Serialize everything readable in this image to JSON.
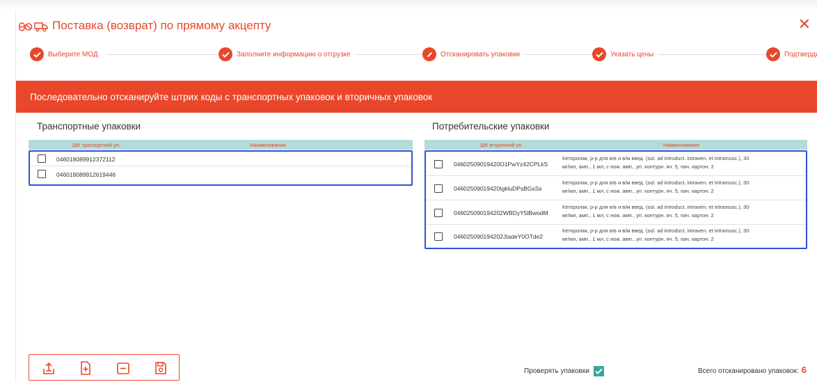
{
  "header": {
    "title": "Поставка (возврат) по прямому акцепту"
  },
  "stepper": [
    {
      "label": "Выберите МОД",
      "icon": "check-icon"
    },
    {
      "label": "Заполните информацию о отгрузке",
      "icon": "check-icon"
    },
    {
      "label": "Отсканировать упаковки",
      "icon": "pencil-icon"
    },
    {
      "label": "Указать цены",
      "icon": "check-icon"
    },
    {
      "label": "Подтвердить",
      "icon": "check-icon"
    }
  ],
  "banner": {
    "text": "Последовательно отсканируйте штрих коды с транспортных упаковок и вторичных упаковок"
  },
  "transport": {
    "title": "Транспортные упаковки",
    "col_code": "ШК траспортной уп.",
    "col_name": "Наименование",
    "rows": [
      {
        "code": "046018089912372112"
      },
      {
        "code": "046018089912619446"
      }
    ]
  },
  "consumer": {
    "title": "Потребительские упаковки",
    "col_code": "ШК вторичной уп.",
    "col_name": "Наименование",
    "rows": [
      {
        "code": "04602509019420O1PwYz42CPLkS",
        "name1": "Кеторолак, р-р для в/в и в/м введ. (sol. ad introduct. intraven. et intramusc.), 30",
        "name2": "мг/мл, амп., 1 мл, с нож. амп., уп. контурн. яч. 5, пач. картон. 2"
      },
      {
        "code": "04602509019420IgkluDPsBGsSs",
        "name1": "Кеторолак, р-р для в/в и в/м введ. (sol. ad introduct. intraven. et intramusc.), 30",
        "name2": "мг/мл, амп., 1 мл, с нож. амп., уп. контурн. яч. 5, пач. картон. 2"
      },
      {
        "code": "046025090194202WBDyY5lBwodM",
        "name1": "Кеторолак, р-р для в/в и в/м введ. (sol. ad introduct. intraven. et intramusc.), 30",
        "name2": "мг/мл, амп., 1 мл, с нож. амп., уп. контурн. яч. 5, пач. картон. 2"
      },
      {
        "code": "046025090194202JtadeY0OTde2",
        "name1": "Кеторолак, р-р для в/в и в/м введ. (sol. ad introduct. intraven. et intramusc.), 30",
        "name2": "мг/мл, амп., 1 мл, с нож. амп., уп. контурн. яч. 5, пач. картон. 2"
      }
    ]
  },
  "footer": {
    "check_label": "Проверять упаковки",
    "check_state": true,
    "total_label": "Всего отсканировано упаковок:",
    "total_value": "6"
  },
  "toolbar": {
    "buttons": [
      "upload-icon",
      "add-file-icon",
      "minus-icon",
      "save-icon"
    ]
  },
  "colors": {
    "accent": "#e8472c",
    "teal": "#b2dcd8",
    "selection": "#2f4fd8",
    "check": "#3ba59a"
  }
}
